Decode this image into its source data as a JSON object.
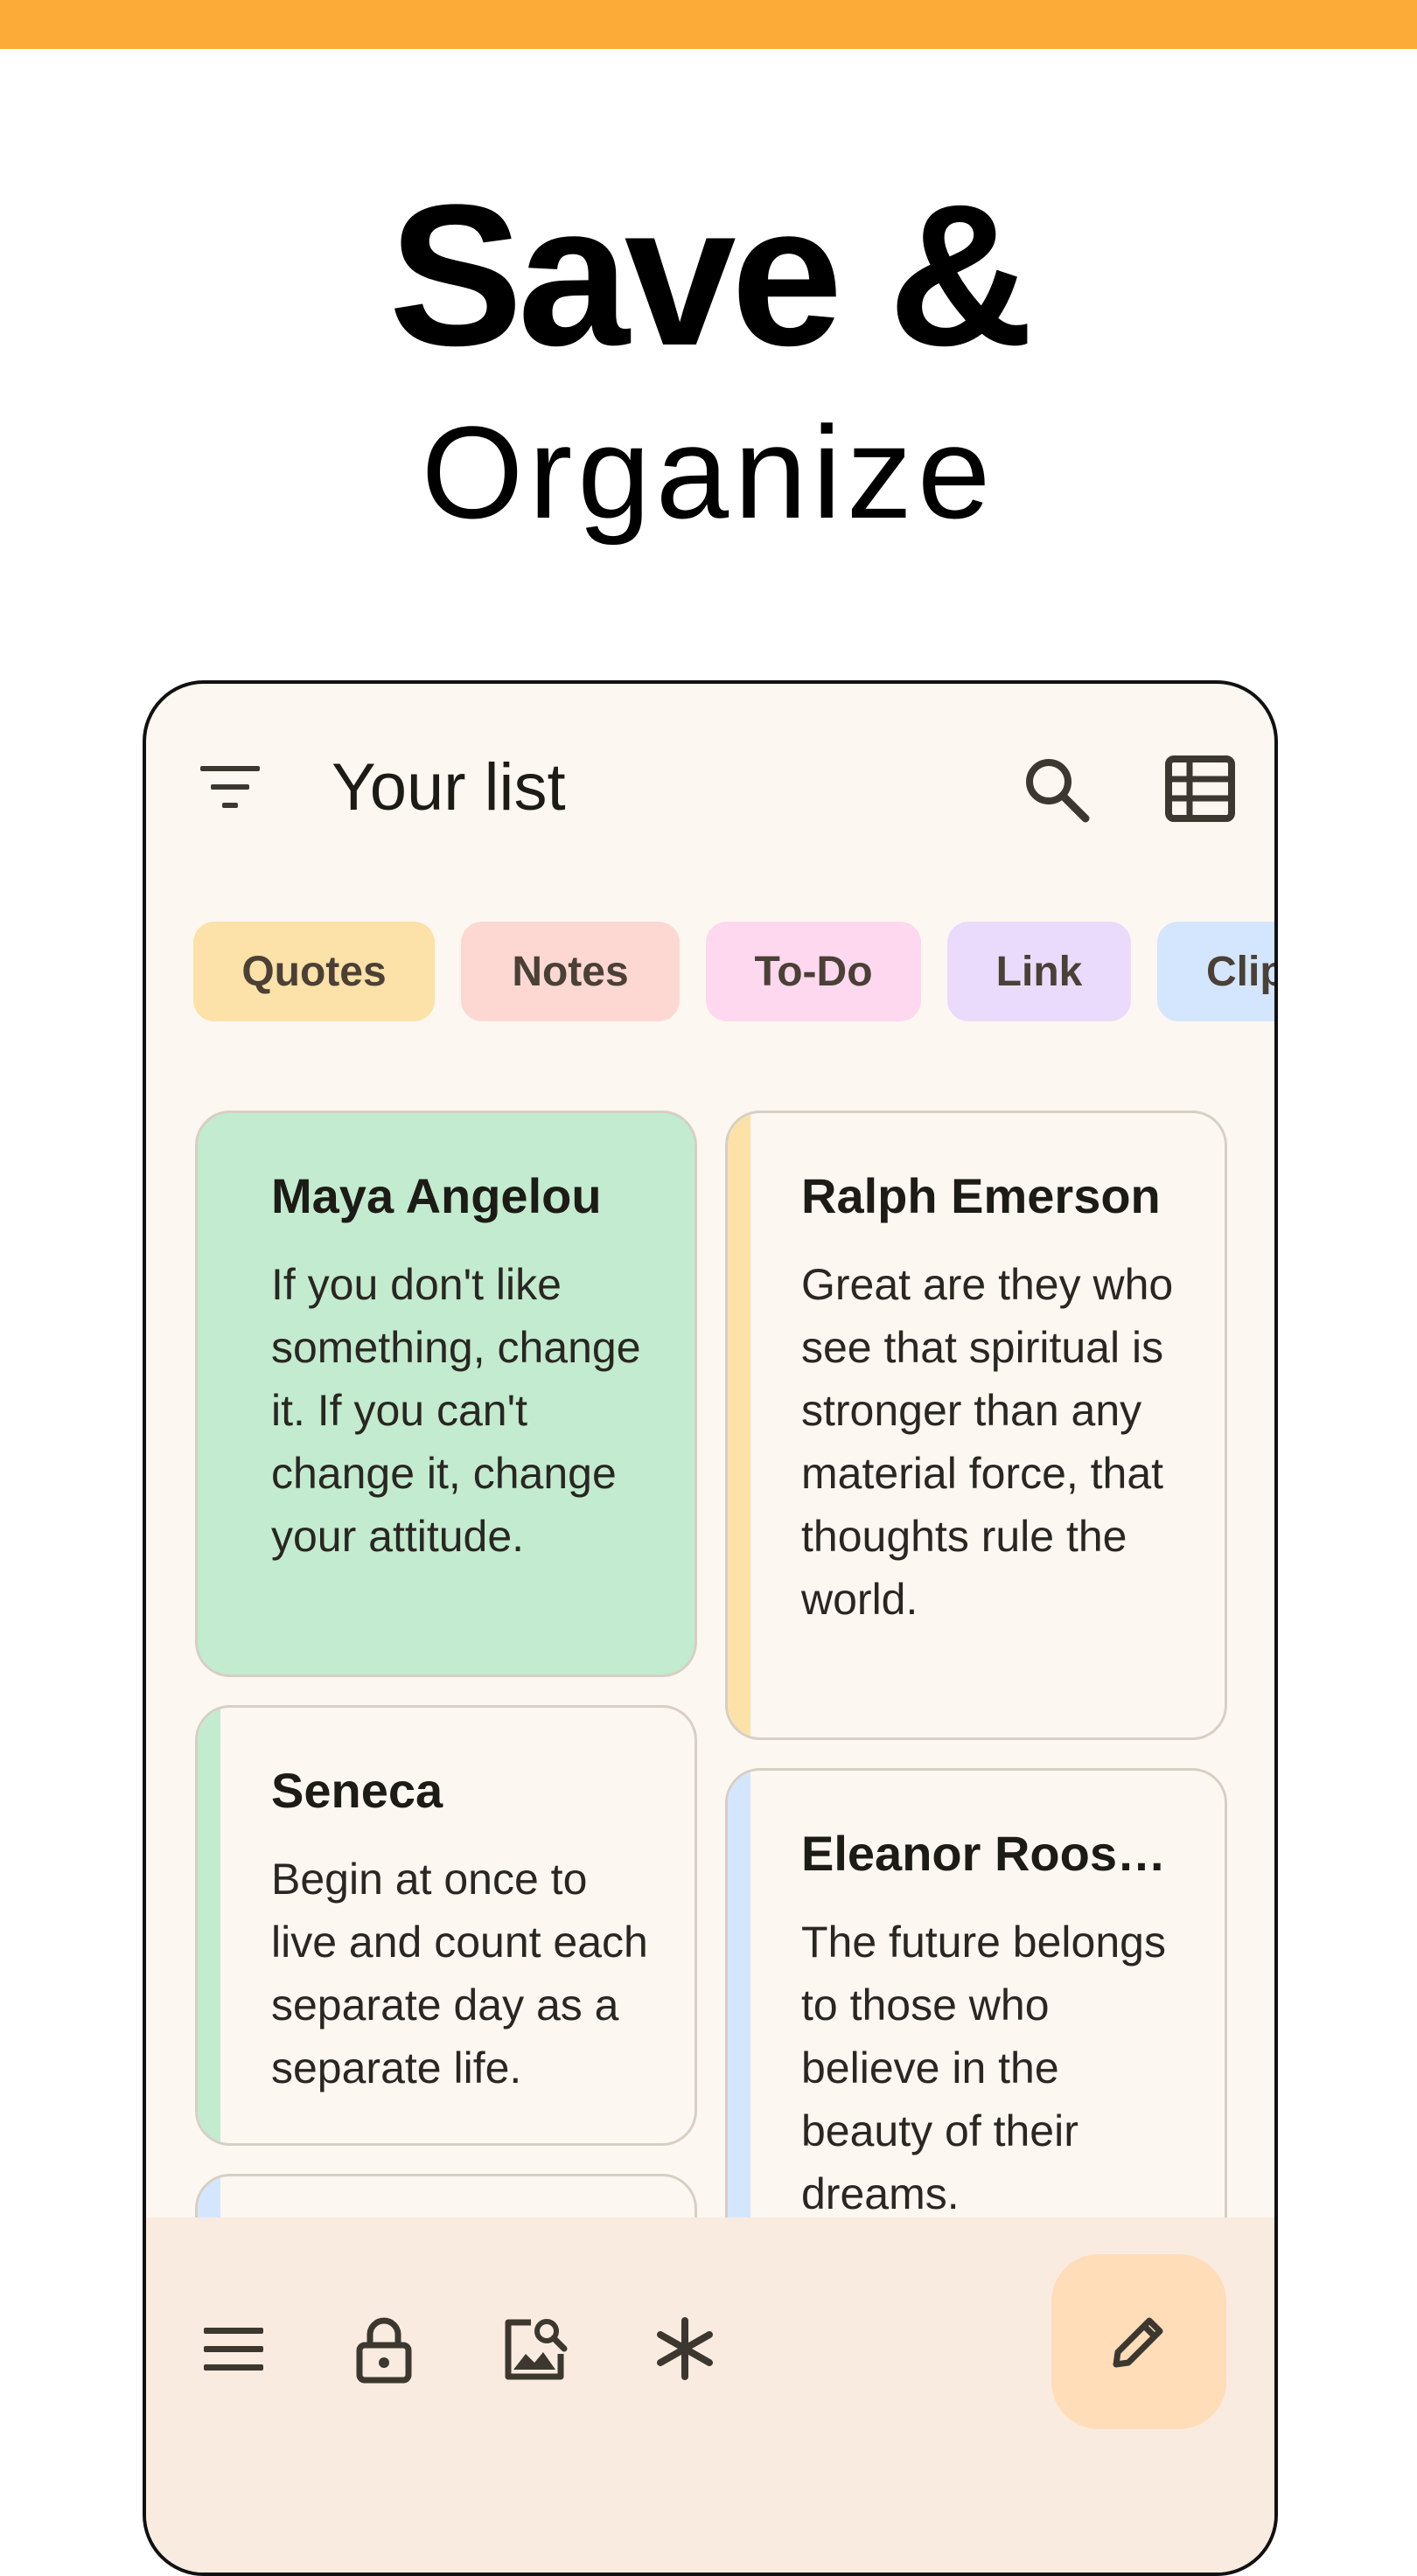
{
  "promo": {
    "line1": "Save &",
    "line2": "Organize"
  },
  "colors": {
    "accent": "#FCAA38",
    "background": "#FDF7F1",
    "bottom_bar": "#FAEBE0",
    "fab": "#FFDDB8"
  },
  "appbar": {
    "title": "Your list",
    "icons": [
      "filter-icon",
      "search-icon",
      "table-view-icon"
    ]
  },
  "chips": [
    {
      "label": "Quotes",
      "color": "#FCE1A8"
    },
    {
      "label": "Notes",
      "color": "#FDD8D3"
    },
    {
      "label": "To-Do",
      "color": "#FDD8EE"
    },
    {
      "label": "Link",
      "color": "#EADBFC"
    },
    {
      "label": "Clip",
      "color": "#D3E6FD"
    }
  ],
  "cards": [
    {
      "title": "Maya Angelou",
      "body": "If you don't like something, change it. If you can't change it, change your attitude.",
      "color": "#C2EBD0"
    },
    {
      "title": "Ralph Emerson",
      "body": "Great are they who see that spiritual is stronger than any material force, that thoughts rule the world.",
      "color": "#FCE1A8"
    },
    {
      "title": "Seneca",
      "body": "Begin at once to live and count each separate day as a separate life.",
      "color": "#C2EBD0"
    },
    {
      "title": "Eleanor Roosevelt",
      "body": "The future belongs to those who believe in the beauty of their dreams.",
      "color": "#D3E6FD"
    },
    {
      "title": "",
      "body": "",
      "color": "#D3E6FD"
    }
  ],
  "bottom_bar": {
    "icons": [
      "menu-icon",
      "lock-icon",
      "image-search-icon",
      "asterisk-icon"
    ],
    "fab_icon": "pencil-icon"
  }
}
